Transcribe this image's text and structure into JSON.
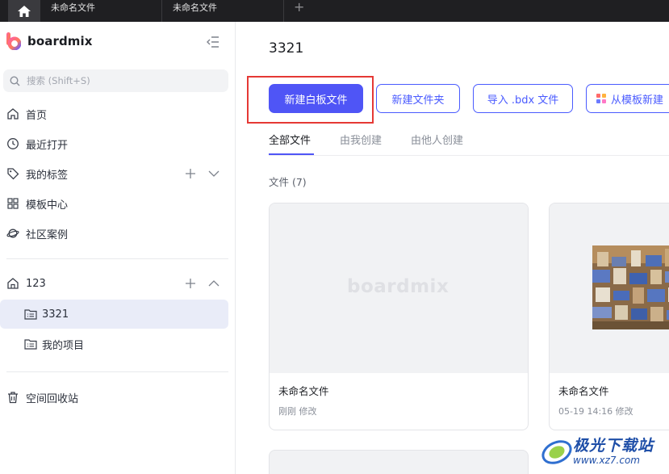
{
  "tabbar": {
    "tabs": [
      "未命名文件",
      "未命名文件"
    ],
    "add_label": "+"
  },
  "sidebar": {
    "brand": "boardmix",
    "search_placeholder": "搜索 (Shift+S)",
    "nav": [
      {
        "label": "首页",
        "icon": "home-icon"
      },
      {
        "label": "最近打开",
        "icon": "clock-icon"
      },
      {
        "label": "我的标签",
        "icon": "tag-icon"
      },
      {
        "label": "模板中心",
        "icon": "grid-icon"
      },
      {
        "label": "社区案例",
        "icon": "planet-icon"
      }
    ],
    "space": {
      "label": "123",
      "icon": "space-icon"
    },
    "space_items": [
      {
        "label": "3321",
        "icon": "folder-list-icon",
        "active": true
      },
      {
        "label": "我的项目",
        "icon": "folder-list-icon",
        "active": false
      }
    ],
    "trash": {
      "label": "空间回收站",
      "icon": "trash-icon"
    }
  },
  "main": {
    "title": "3321",
    "buttons": {
      "new_board": "新建白板文件",
      "new_folder": "新建文件夹",
      "import": "导入 .bdx 文件",
      "from_template": "从模板新建"
    },
    "filter_tabs": [
      "全部文件",
      "由我创建",
      "由他人创建"
    ],
    "active_tab": "全部文件",
    "files_count_label": "文件 (7)",
    "cards": [
      {
        "name": "未命名文件",
        "meta": "刚刚 修改",
        "thumb_watermark": "boardmix"
      },
      {
        "name": "未命名文件",
        "meta": "05-19 14:16 修改"
      }
    ]
  },
  "site_watermark": {
    "name": "极光下载站",
    "url": "www.xz7.com"
  },
  "colors": {
    "accent": "#4f55f6",
    "highlight": "#e53935",
    "tabbar_bg": "#1f1f22",
    "active_nav_bg": "#e9ecf8"
  }
}
